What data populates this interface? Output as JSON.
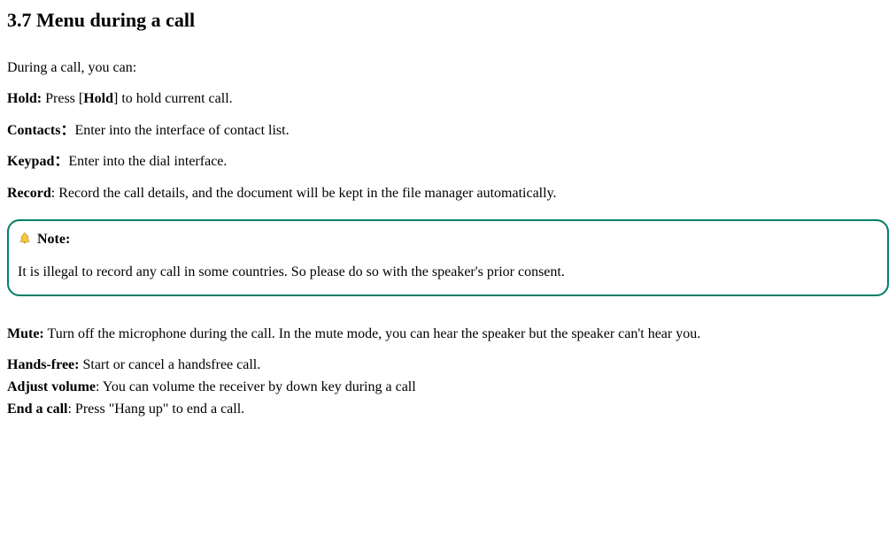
{
  "heading": "3.7 Menu during a call",
  "intro": "During a call, you can:",
  "hold": {
    "label": "Hold:",
    "text_before": " Press [",
    "inner_bold": "Hold",
    "text_after": "] to hold current call."
  },
  "contacts": {
    "label": "Contacts：",
    "text": "Enter into the interface of contact list."
  },
  "keypad": {
    "label": "Keypad：",
    "text": "Enter into the dial interface."
  },
  "record": {
    "label": "Record",
    "text": ": Record the call details, and the document will be kept in the file manager automatically."
  },
  "note": {
    "title": "Note:",
    "body": "It is illegal to record any call in some countries. So please do so with the speaker's prior consent."
  },
  "mute": {
    "label": "Mute:",
    "text": " Turn off the microphone during the call. In the mute mode, you can hear the speaker but the speaker can't hear you."
  },
  "handsfree": {
    "label": "Hands-free:",
    "text": " Start or cancel a handsfree call."
  },
  "adjustvolume": {
    "label": "Adjust volume",
    "text": ": You can volume the receiver by down key during a call"
  },
  "endcall": {
    "label": "End a call",
    "text": ": Press \"Hang up\" to end a call."
  }
}
